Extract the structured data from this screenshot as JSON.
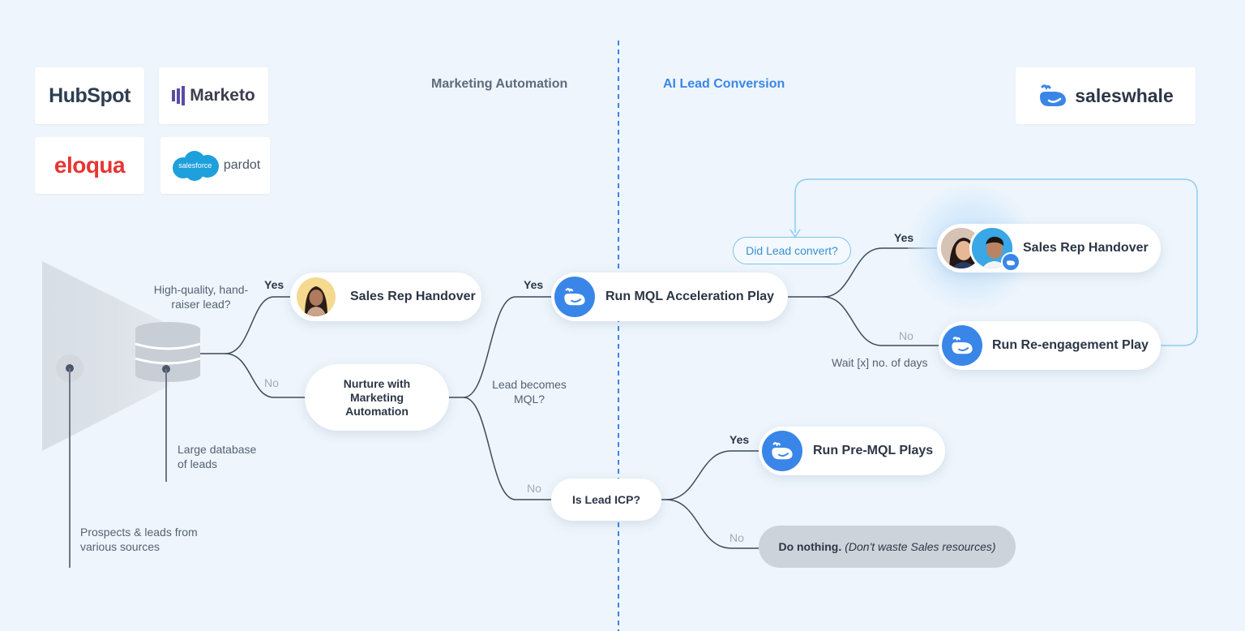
{
  "logos": {
    "hubspot": "HubSpot",
    "marketo": "Marketo",
    "eloqua": "eloqua",
    "salesforce": "salesforce",
    "pardot": "pardot",
    "saleswhale": "saleswhale"
  },
  "sections": {
    "left": "Marketing Automation",
    "right": "AI Lead Conversion"
  },
  "labels": {
    "high_quality": "High-quality, hand-raiser lead?",
    "large_db": "Large database of leads",
    "prospects": "Prospects & leads from various sources",
    "lead_mql": "Lead becomes MQL?",
    "wait_days": "Wait [x] no. of days"
  },
  "branches": {
    "yes": "Yes",
    "no": "No"
  },
  "nodes": {
    "sales_rep_1": "Sales Rep Handover",
    "nurture": "Nurture with Marketing Automation",
    "mql_accel": "Run MQL Acceleration Play",
    "is_icp": "Is Lead ICP?",
    "did_convert": "Did Lead convert?",
    "sales_rep_2": "Sales Rep Handover",
    "reengage": "Run Re-engagement Play",
    "pre_mql": "Run Pre-MQL Plays",
    "do_nothing_bold": "Do nothing.",
    "do_nothing_italic": "(Don't waste Sales resources)"
  },
  "colors": {
    "background": "#eef5fc",
    "accent_blue": "#3a86e8",
    "line": "#3d4a5c",
    "loop": "#8ccdf0",
    "divider": "#3a86e8",
    "muted_node": "#cdd3da"
  }
}
